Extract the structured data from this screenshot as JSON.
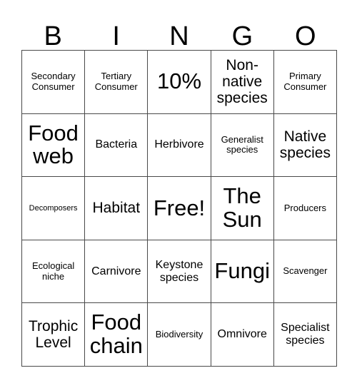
{
  "card": {
    "title_letters": [
      "B",
      "I",
      "N",
      "G",
      "O"
    ],
    "free_space_label": "Free!",
    "rows": [
      [
        {
          "text": "Secondary Consumer",
          "size": "sm"
        },
        {
          "text": "Tertiary Consumer",
          "size": "sm"
        },
        {
          "text": "10%",
          "size": "xl"
        },
        {
          "text": "Non-native species",
          "size": "lg"
        },
        {
          "text": "Primary Consumer",
          "size": "sm"
        }
      ],
      [
        {
          "text": "Food web",
          "size": "xl"
        },
        {
          "text": "Bacteria",
          "size": "md"
        },
        {
          "text": "Herbivore",
          "size": "md"
        },
        {
          "text": "Generalist species",
          "size": "sm"
        },
        {
          "text": "Native species",
          "size": "lg"
        }
      ],
      [
        {
          "text": "Decomposers",
          "size": "xs"
        },
        {
          "text": "Habitat",
          "size": "lg"
        },
        {
          "text": "Free!",
          "size": "xl"
        },
        {
          "text": "The Sun",
          "size": "xl"
        },
        {
          "text": "Producers",
          "size": "sm"
        }
      ],
      [
        {
          "text": "Ecological niche",
          "size": "sm"
        },
        {
          "text": "Carnivore",
          "size": "md"
        },
        {
          "text": "Keystone species",
          "size": "md"
        },
        {
          "text": "Fungi",
          "size": "xl"
        },
        {
          "text": "Scavenger",
          "size": "sm"
        }
      ],
      [
        {
          "text": "Trophic Level",
          "size": "lg"
        },
        {
          "text": "Food chain",
          "size": "xl"
        },
        {
          "text": "Biodiversity",
          "size": "sm"
        },
        {
          "text": "Omnivore",
          "size": "md"
        },
        {
          "text": "Specialist species",
          "size": "md"
        }
      ]
    ],
    "colors": {
      "background": "#ffffff",
      "text": "#000000",
      "border": "#4a4a4a"
    }
  }
}
